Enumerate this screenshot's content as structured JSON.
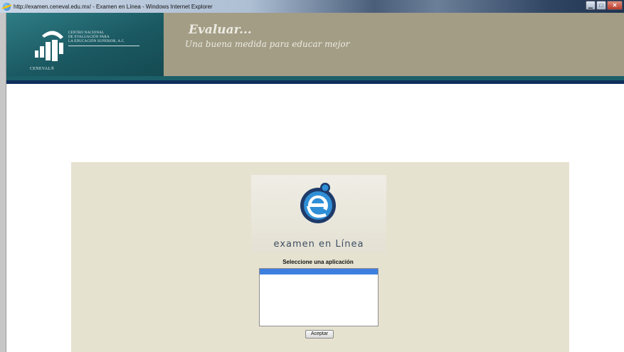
{
  "window": {
    "title": "http://examen.ceneval.edu.mx/ - Examen en Línea - Windows Internet Explorer",
    "minimize_label": "▁",
    "maximize_label": "□",
    "close_label": "✕"
  },
  "header": {
    "org_lines": [
      "CENTRO NACIONAL",
      "DE EVALUACIÓN PARA",
      "LA EDUCACIÓN SUPERIOR, A.C."
    ],
    "brand": "CENEVAL®",
    "slogan_title": "Evaluar...",
    "slogan_sub": "Una buena medida para educar mejor"
  },
  "main": {
    "exam_logo_text": "examen en Línea",
    "select_label": "Seleccione una aplicación",
    "options": [
      ""
    ],
    "accept_label": "Aceptar"
  },
  "colors": {
    "header_bg": "#a39d85",
    "logo_bg": "#1b5962",
    "panel_bg": "#e6e2d0",
    "selection": "#3d7fde"
  }
}
